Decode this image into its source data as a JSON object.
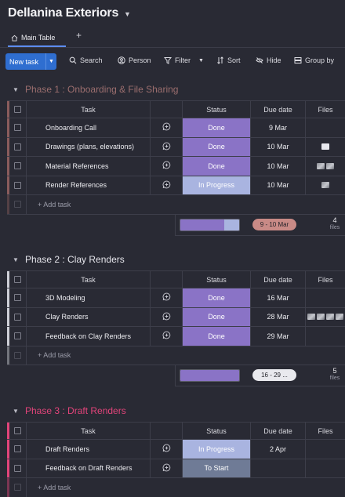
{
  "board": {
    "title": "Dellanina Exteriors",
    "tab": "Main Table",
    "tab_add": "+"
  },
  "toolbar": {
    "new_task": "New task",
    "search": "Search",
    "person": "Person",
    "filter": "Filter",
    "sort": "Sort",
    "hide": "Hide",
    "group_by": "Group by"
  },
  "columns": {
    "task": "Task",
    "status": "Status",
    "due": "Due date",
    "files": "Files"
  },
  "add_task": "+ Add task",
  "colors": {
    "done": "#8a73c6",
    "in_progress": "#a9b4e0",
    "to_start": "#6f7b96",
    "phase1": "#8a5c5c",
    "phase2": "#cfd0d8",
    "phase3": "#e2447a"
  },
  "groups": [
    {
      "title": "Phase 1 : Onboarding & File Sharing",
      "color": "#8a5c5c",
      "title_color": "#9b6e6e",
      "rows": [
        {
          "task": "Onboarding Call",
          "status": "Done",
          "due": "9 Mar",
          "files": []
        },
        {
          "task": "Drawings (plans, elevations)",
          "status": "Done",
          "due": "10 Mar",
          "files": [
            "doc"
          ]
        },
        {
          "task": "Material References",
          "status": "Done",
          "due": "10 Mar",
          "files": [
            "img",
            "img"
          ]
        },
        {
          "task": "Render References",
          "status": "In Progress",
          "due": "10 Mar",
          "files": [
            "img"
          ]
        }
      ],
      "summary": {
        "done_fraction": 0.75,
        "progress_fraction": 0.25,
        "dates": "9 - 10 Mar",
        "files_count": "4",
        "files_label": "files"
      }
    },
    {
      "title": "Phase 2 : Clay Renders",
      "color": "#cfd0d8",
      "title_color": "#e4e4ea",
      "rows": [
        {
          "task": "3D Modeling",
          "status": "Done",
          "due": "16 Mar",
          "files": []
        },
        {
          "task": "Clay Renders",
          "status": "Done",
          "due": "28 Mar",
          "files": [
            "img",
            "img",
            "img",
            "img"
          ]
        },
        {
          "task": "Feedback on Clay Renders",
          "status": "Done",
          "due": "29 Mar",
          "files": []
        }
      ],
      "summary": {
        "done_fraction": 1.0,
        "progress_fraction": 0,
        "dates": "16 - 29 ...",
        "files_count": "5",
        "files_label": "files"
      }
    },
    {
      "title": "Phase 3 : Draft Renders",
      "color": "#e2447a",
      "title_color": "#e2447a",
      "rows": [
        {
          "task": "Draft Renders",
          "status": "In Progress",
          "due": "2 Apr",
          "files": []
        },
        {
          "task": "Feedback on Draft Renders",
          "status": "To Start",
          "due": "",
          "files": []
        }
      ]
    }
  ]
}
